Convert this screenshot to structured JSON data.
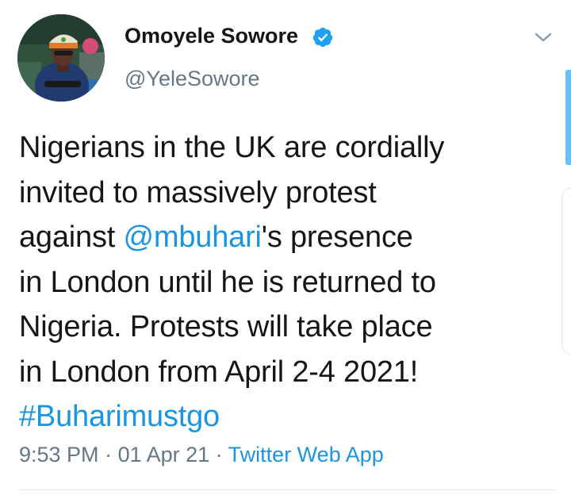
{
  "author": {
    "display_name": "Omoyele Sowore",
    "handle": "@YeleSowore",
    "verified": true,
    "avatar_icon": "profile-photo"
  },
  "tweet": {
    "line1": "Nigerians in the UK are cordially",
    "line2": "invited to massively protest",
    "line3_prefix": "against ",
    "mention": "@mbuhari",
    "line3_suffix": "'s presence",
    "line4": "in London until he is returned to",
    "line5": "Nigeria. Protests will take place",
    "line6": "in London from April 2-4 2021!",
    "hashtag": "#Buharimustgo"
  },
  "meta": {
    "time": "9:53 PM",
    "sep1": " · ",
    "date": "01 Apr 21",
    "sep2": " · ",
    "source": "Twitter Web App"
  },
  "colors": {
    "link": "#1b95e0",
    "secondary_text": "#657786",
    "primary_text": "#14171a",
    "verified_badge": "#1da1f2"
  }
}
